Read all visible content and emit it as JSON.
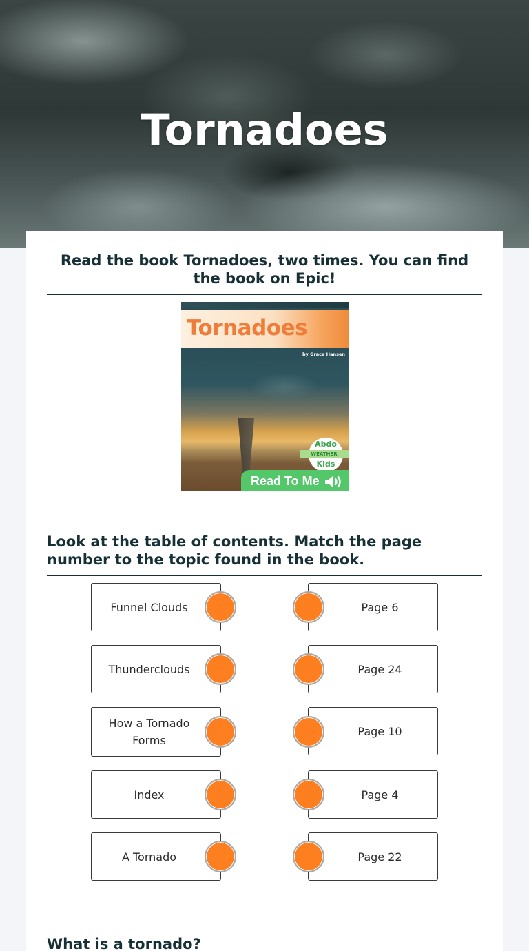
{
  "hero": {
    "title": "Tornadoes",
    "background": "storm-clouds-image"
  },
  "sections": [
    {
      "heading": "Read the book Tornadoes, two times. You can find the book on Epic!",
      "book_cover": {
        "title": "Tornadoes",
        "author": "by Grace Hansen",
        "publisher_top": "Abdo",
        "series": "WEATHER",
        "publisher_bottom": "Kids",
        "read_to_me_label": "Read To Me",
        "icon": "speaker-icon"
      }
    },
    {
      "heading": "Look at the table of contents. Match the page number to the topic found in the book.",
      "matching": {
        "left": [
          "Funnel Clouds",
          "Thunderclouds",
          "How a Tornado Forms",
          "Index",
          "A Tornado"
        ],
        "right": [
          "Page 6",
          "Page 24",
          "Page 10",
          "Page 4",
          "Page 22"
        ],
        "connector_color": "#fd7f1f"
      }
    },
    {
      "heading": "What is a tornado?"
    }
  ],
  "colors": {
    "heading": "#173036",
    "page_bg": "#f4f5f8",
    "card_bg": "#ffffff",
    "read_to_me_green": "#55c76b",
    "book_title_orange": "#ef7d3a"
  }
}
